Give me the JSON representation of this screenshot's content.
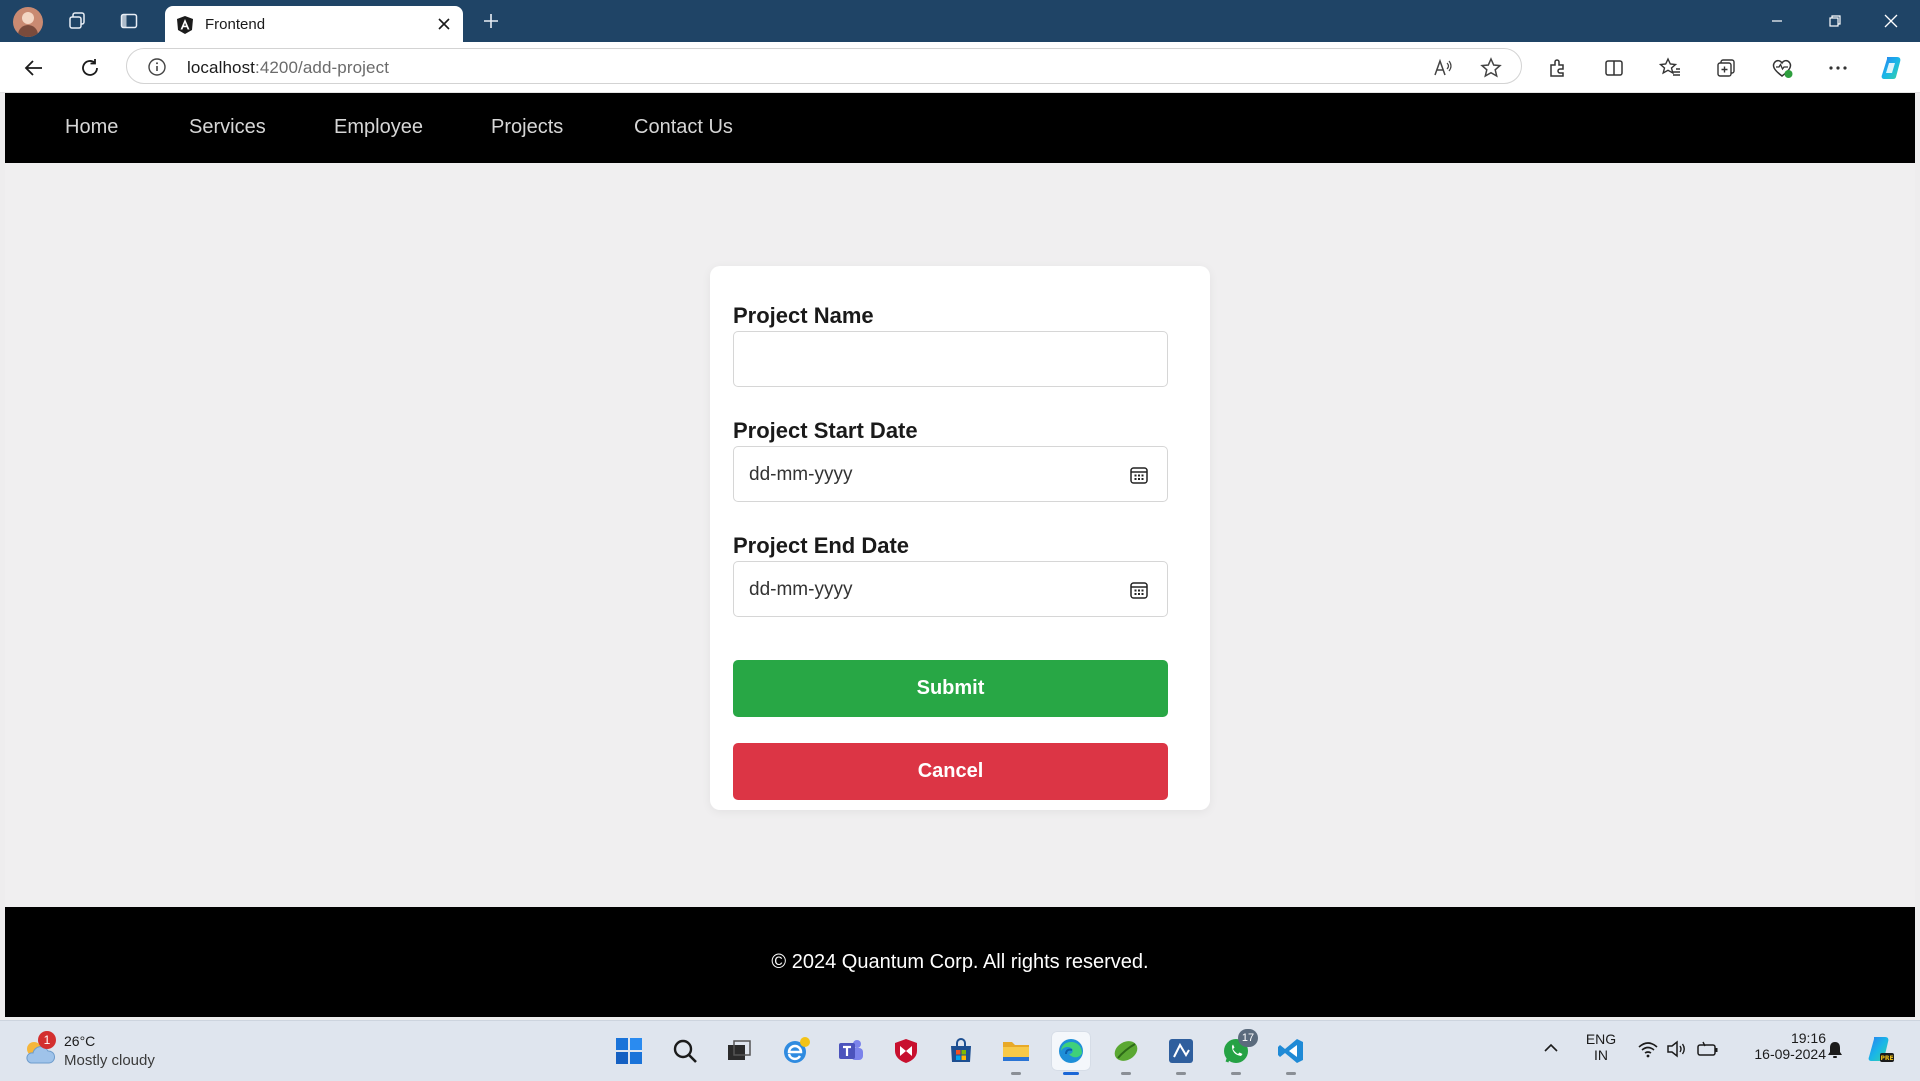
{
  "browser": {
    "tab_title": "Frontend",
    "url_host": "localhost",
    "url_path": ":4200/add-project"
  },
  "navbar": {
    "links": [
      "Home",
      "Services",
      "Employee",
      "Projects",
      "Contact Us"
    ]
  },
  "form": {
    "project_name_label": "Project Name",
    "project_name_value": "",
    "start_date_label": "Project Start Date",
    "start_date_placeholder": "dd-mm-yyyy",
    "end_date_label": "Project End Date",
    "end_date_placeholder": "dd-mm-yyyy",
    "submit_label": "Submit",
    "cancel_label": "Cancel"
  },
  "footer": {
    "text": "© 2024 Quantum Corp. All rights reserved."
  },
  "taskbar": {
    "weather_badge": "1",
    "weather_temp": "26°C",
    "weather_condition": "Mostly cloudy",
    "whatsapp_badge": "17",
    "lang_line1": "ENG",
    "lang_line2": "IN",
    "time": "19:16",
    "date": "16-09-2024",
    "apps": [
      "windows-start-icon",
      "search-icon",
      "file-manager-icon",
      "ie-icon",
      "teams-icon",
      "mcafee-icon",
      "store-icon",
      "folder-icon",
      "edge-icon",
      "bluej-icon",
      "remote-app-icon",
      "whatsapp-icon",
      "vscode-icon"
    ]
  },
  "colors": {
    "submit": "#28a745",
    "cancel": "#dc3545",
    "navbar": "#000000",
    "titlebar": "#1f4466"
  }
}
